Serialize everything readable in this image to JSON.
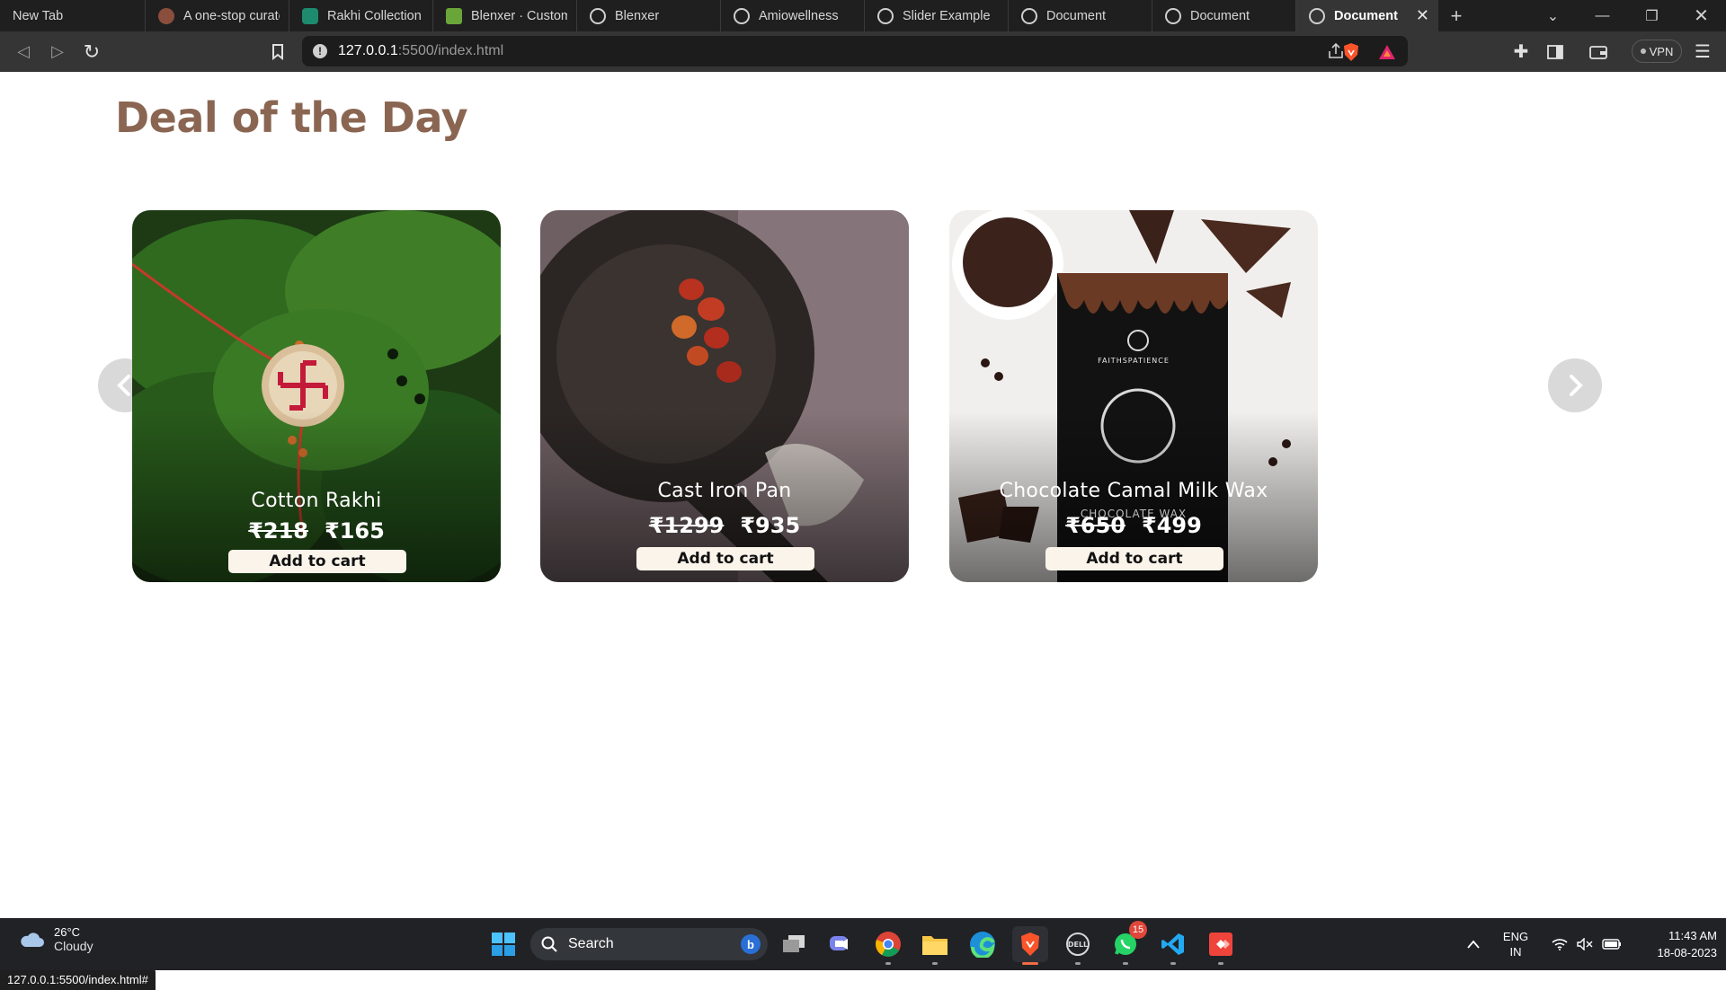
{
  "browser": {
    "tabs": [
      {
        "label": "New Tab",
        "icon": "none"
      },
      {
        "label": "A one-stop curate",
        "icon": "site-avatar-icon"
      },
      {
        "label": "Rakhi Collection B",
        "icon": "chatgpt-icon"
      },
      {
        "label": "Blenxer · Customiz",
        "icon": "shopify-icon"
      },
      {
        "label": "Blenxer",
        "icon": "globe-icon"
      },
      {
        "label": "Amiowellness",
        "icon": "globe-icon"
      },
      {
        "label": "Slider Example",
        "icon": "globe-icon"
      },
      {
        "label": "Document",
        "icon": "globe-icon"
      },
      {
        "label": "Document",
        "icon": "globe-icon"
      },
      {
        "label": "Document",
        "icon": "globe-icon",
        "active": true
      }
    ],
    "url_host": "127.0.0.1",
    "url_rest": ":5500/index.html",
    "vpn_label": "VPN",
    "status_url": "127.0.0.1:5500/index.html#"
  },
  "page": {
    "title": "Deal of the Day",
    "products": [
      {
        "name": "Cotton Rakhi",
        "old_price": "₹218",
        "new_price": "₹165",
        "button": "Add to cart"
      },
      {
        "name": "Cast Iron Pan",
        "old_price": "₹1299",
        "new_price": "₹935",
        "button": "Add to cart"
      },
      {
        "name": "Chocolate Camal Milk Wax",
        "old_price": "₹650",
        "new_price": "₹499",
        "button": "Add to cart",
        "package_brand": "FAITHSPATIENCE",
        "package_text": "CHOCOLATE WAX"
      }
    ],
    "accent_color": "#8a6652"
  },
  "taskbar": {
    "weather_temp": "26°C",
    "weather_cond": "Cloudy",
    "search_label": "Search",
    "whatsapp_badge": "15",
    "lang_top": "ENG",
    "lang_bottom": "IN",
    "time": "11:43 AM",
    "date": "18-08-2023"
  }
}
